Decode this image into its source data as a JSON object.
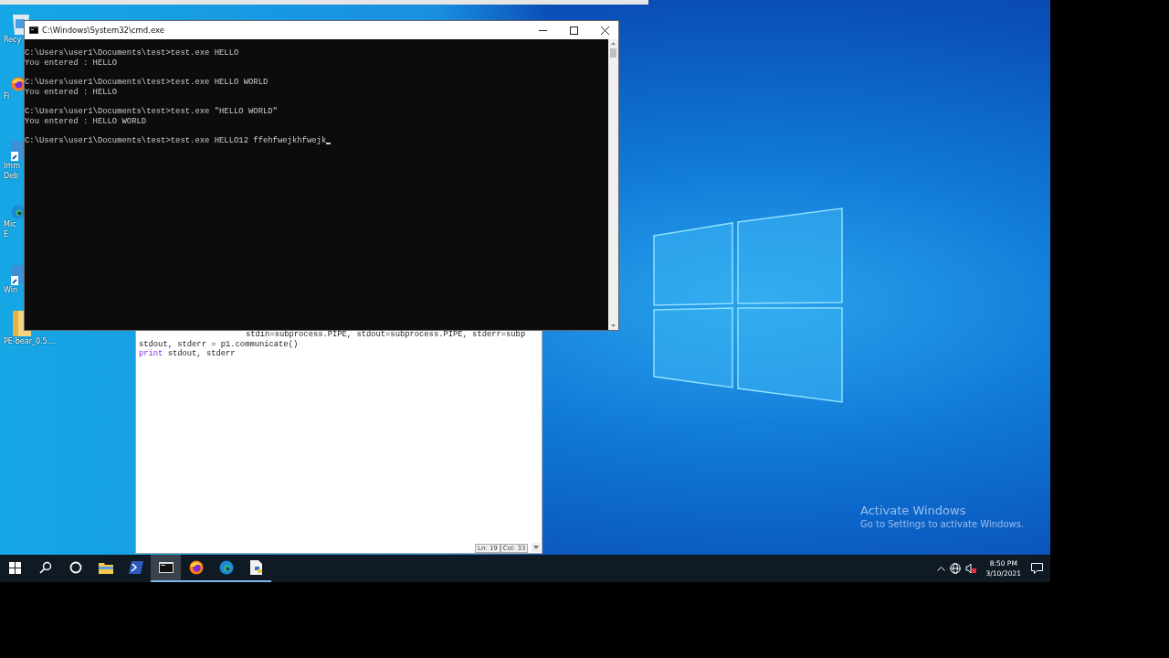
{
  "desktop_icons": [
    {
      "kind": "bin",
      "label_lines": [
        "Recy"
      ]
    },
    {
      "kind": "firefox",
      "label_lines": [
        "Fi"
      ]
    },
    {
      "kind": "app",
      "label_lines": [
        "Imm",
        "Deb"
      ]
    },
    {
      "kind": "edge",
      "label_lines": [
        "Mic",
        "E"
      ]
    },
    {
      "kind": "app",
      "label_lines": [
        "Win"
      ]
    },
    {
      "kind": "folder",
      "label_lines": [
        "PE-bear_0.5...."
      ]
    }
  ],
  "editor": {
    "lines": [
      {
        "kind": "continuation",
        "text": "stdin=subprocess.PIPE, stdout=subprocess.PIPE, stderr=subp"
      },
      {
        "kind": "plain",
        "text": "stdout, stderr = p1.communicate()"
      },
      {
        "kind": "keyword",
        "keyword": "print",
        "text": "stdout, stderr"
      }
    ],
    "status": [
      "Ln: 19",
      "Col: 33"
    ]
  },
  "console": {
    "title": "C:\\Windows\\System32\\cmd.exe",
    "blocks": [
      {
        "lines": [
          "C:\\Users\\user1\\Documents\\test>test.exe HELLO",
          "You entered : HELLO"
        ],
        "cursor": false
      },
      {
        "lines": [
          "C:\\Users\\user1\\Documents\\test>test.exe HELLO WORLD",
          "You entered : HELLO"
        ],
        "cursor": false
      },
      {
        "lines": [
          "C:\\Users\\user1\\Documents\\test>test.exe \"HELLO WORLD\"",
          "You entered : HELLO WORLD"
        ],
        "cursor": false
      },
      {
        "lines": [
          "C:\\Users\\user1\\Documents\\test>test.exe HELLO12 ffehfwejkhfwejk"
        ],
        "cursor": true
      }
    ]
  },
  "activation": {
    "title": "Activate Windows",
    "message": "Go to Settings to activate Windows."
  },
  "taskbar": {
    "apps": [
      {
        "kind": "start",
        "selected": false,
        "running": false
      },
      {
        "kind": "search",
        "selected": false,
        "running": false
      },
      {
        "kind": "cortana",
        "selected": false,
        "running": false
      },
      {
        "kind": "explorer",
        "selected": false,
        "running": false
      },
      {
        "kind": "powershell",
        "selected": false,
        "running": false
      },
      {
        "kind": "terminal",
        "selected": true,
        "running": true
      },
      {
        "kind": "firefox",
        "selected": false,
        "running": true
      },
      {
        "kind": "edge",
        "selected": false,
        "running": true
      },
      {
        "kind": "python-file",
        "selected": false,
        "running": true
      }
    ],
    "time": "8:50 PM",
    "date": "3/10/2021"
  }
}
